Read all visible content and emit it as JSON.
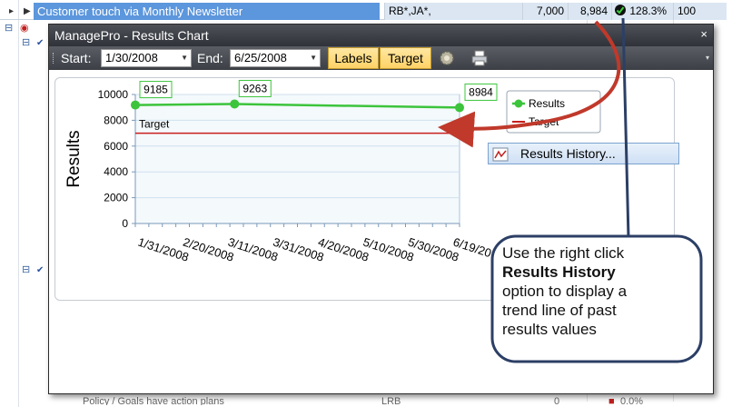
{
  "background": {
    "selected_row_text": "Customer touch via Monthly Newsletter",
    "cells": [
      "RB*,JA*,",
      "7,000",
      "8,984",
      "128.3%",
      "100"
    ],
    "bottom_row_text": "Policy / Goals have action plans",
    "bottom_row_cells": [
      "LRB",
      "0",
      "0.0%"
    ]
  },
  "dialog": {
    "title": "ManagePro - Results Chart",
    "close": "×",
    "toolbar": {
      "start_label": "Start:",
      "start_value": "1/30/2008",
      "end_label": "End:",
      "end_value": "6/25/2008",
      "labels_button": "Labels",
      "target_button": "Target",
      "settings_icon": "gear-icon",
      "print_icon": "printer-icon",
      "overflow": "▾"
    }
  },
  "chart_data": {
    "type": "line",
    "ylabel": "Results",
    "xlabel": "",
    "ylim": [
      0,
      10000
    ],
    "y_ticks": [
      "0",
      "2000",
      "4000",
      "6000",
      "8000",
      "10000"
    ],
    "x_ticks": [
      "1/31/2008",
      "2/20/2008",
      "3/11/2008",
      "3/31/2008",
      "4/20/2008",
      "5/10/2008",
      "5/30/2008",
      "6/19/20"
    ],
    "series": [
      {
        "name": "Results",
        "color": "#3cc43c",
        "points": [
          {
            "x": "1/30/2008",
            "y": 9185,
            "label": "9185"
          },
          {
            "x": "3/15/2008",
            "y": 9263,
            "label": "9263"
          },
          {
            "x": "6/25/2008",
            "y": 8984,
            "label": "8984"
          }
        ]
      },
      {
        "name": "Target",
        "color": "#c81e1e",
        "value": 7000,
        "annotation": "Target"
      }
    ],
    "legend": [
      "Results",
      "Target"
    ],
    "legend_position": "top-right",
    "grid": true
  },
  "context_menu": {
    "item_label": "Results History...",
    "icon": "chart-line-icon"
  },
  "callout": {
    "line1": "Use the right click",
    "bold": "Results History",
    "line3": "option to display a",
    "line4": "trend line of past",
    "line5": "results values"
  },
  "colors": {
    "selection": "#5c96dc",
    "titlebar": "#3a3e44",
    "button": "#ffd266",
    "arrow": "#c0392b",
    "callout_border": "#2c3f66"
  }
}
